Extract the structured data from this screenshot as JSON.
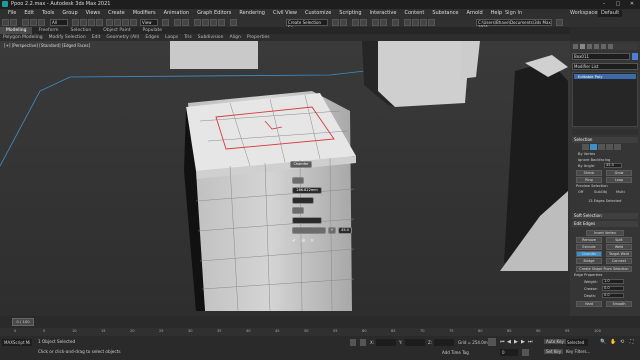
{
  "title": "Ppoo 2.2.max - Autodesk 3ds Max 2021",
  "menu": [
    "File",
    "Edit",
    "Tools",
    "Group",
    "Views",
    "Create",
    "Modifiers",
    "Animation",
    "Graph Editors",
    "Rendering",
    "Civil View",
    "Customize",
    "Scripting",
    "Interactive",
    "Content",
    "Substance",
    "Arnold",
    "Help"
  ],
  "signin": "Sign In",
  "workspaces_label": "Workspaces:",
  "workspaces_value": "Default",
  "toolbar": {
    "filter": "All",
    "view": "View",
    "selection_set": "Create Selection Se",
    "path": "C:\\Users\\Bhave\\Documents\\3ds Max 2021"
  },
  "ribbon_tabs": [
    "Modeling",
    "Freeform",
    "Selection",
    "Object Paint",
    "Populate"
  ],
  "ribbon_sub": [
    "Polygon Modeling",
    "Modify Selection",
    "Edit",
    "Geometry (All)",
    "Edges",
    "Loops",
    "Tris",
    "Subdivision",
    "Align",
    "Properties"
  ],
  "viewport_label": "[+] [Perspective] [Standard] [Edged Faces]",
  "quad": {
    "header": "Chamfer",
    "amount": "286.822mm",
    "plus": "+",
    "last": "45.0"
  },
  "cmd": {
    "object_name": "Box011",
    "modifier_list": "Modifier List",
    "stack_item": "Editable Poly",
    "selection_title": "Selection",
    "by_vertex": "By Vertex",
    "ignore_backfacing": "Ignore Backfacing",
    "by_angle": "By Angle:",
    "by_angle_val": "45.0",
    "shrink": "Shrink",
    "grow": "Grow",
    "ring": "Ring",
    "loop": "Loop",
    "preview_selection": "Preview Selection",
    "off": "Off",
    "subobj": "SubObj",
    "multi": "Multi",
    "edges_selected": "13 Edges Selected",
    "soft_selection": "Soft Selection",
    "edit_edges": "Edit Edges",
    "insert_vertex": "Insert Vertex",
    "remove": "Remove",
    "split": "Split",
    "extrude": "Extrude",
    "weld": "Weld",
    "chamfer": "Chamfer",
    "target_weld": "Target Weld",
    "bridge": "Bridge",
    "connect": "Connect",
    "create_shape": "Create Shape From Selection",
    "edge_properties": "Edge Properties",
    "weight": "Weight:",
    "weight_val": "1.0",
    "crease": "Crease:",
    "crease_val": "0.0",
    "depth": "Depth:",
    "depth_val": "0.0",
    "hard": "Hard",
    "smooth": "Smooth"
  },
  "timeline": {
    "frame": "0 / 100",
    "ticks": [
      "0",
      "5",
      "10",
      "15",
      "20",
      "25",
      "30",
      "35",
      "40",
      "45",
      "50",
      "55",
      "60",
      "65",
      "70",
      "75",
      "80",
      "85",
      "90",
      "95",
      "100"
    ]
  },
  "status": {
    "maxscript": "MAXScript Mi",
    "selected": "1 Object Selected",
    "prompt": "Click or click-and-drag to select objects",
    "x": "X:",
    "y": "Y:",
    "z": "Z:",
    "grid": "Grid = 254.0mm",
    "add_time_tag": "Add Time Tag",
    "auto_key": "Auto Key",
    "selected_dd": "Selected",
    "set_key": "Set Key",
    "key_filters": "Key Filters...",
    "frame": "0"
  },
  "colors": {
    "accent": "#3d8ec9",
    "selected_edge": "#d43a3a",
    "bg": "#2b2b2b"
  }
}
